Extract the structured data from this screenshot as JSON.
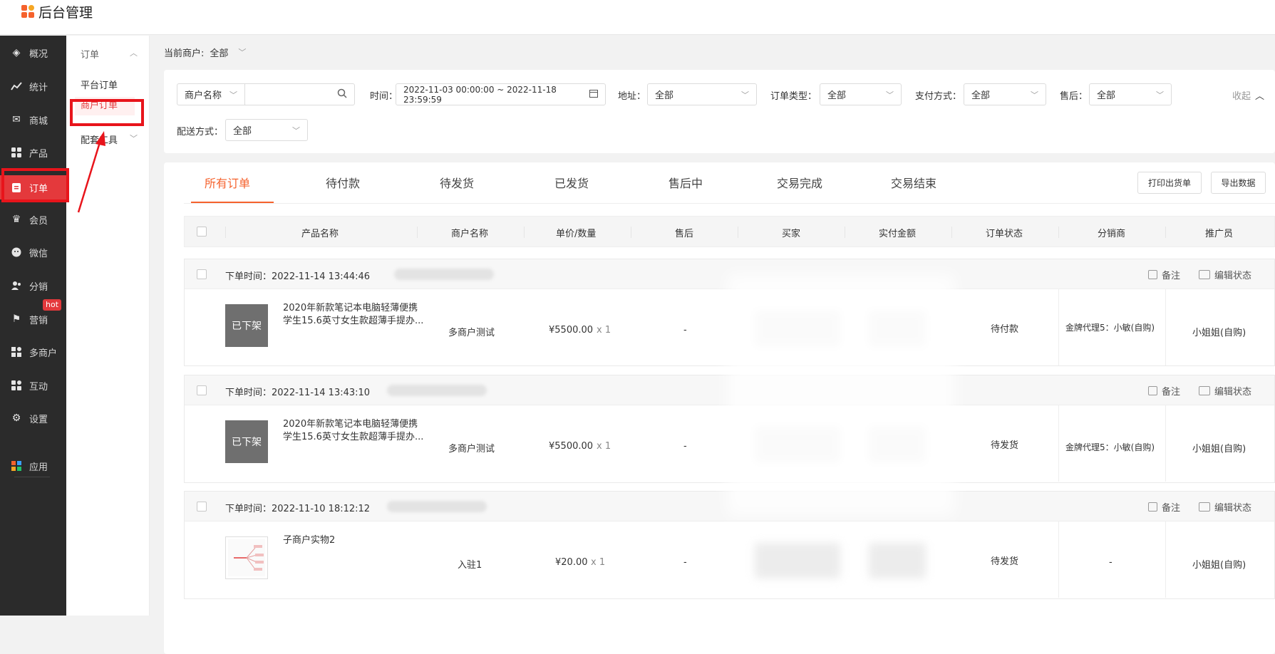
{
  "brand": {
    "title": "后台管理"
  },
  "sidebar": {
    "items": [
      {
        "label": "概况",
        "icon": "layers-icon"
      },
      {
        "label": "统计",
        "icon": "chart-icon"
      },
      {
        "label": "商城",
        "icon": "mail-icon"
      },
      {
        "label": "产品",
        "icon": "grid-icon"
      },
      {
        "label": "订单",
        "icon": "clipboard-icon",
        "active": true
      },
      {
        "label": "会员",
        "icon": "crown-icon"
      },
      {
        "label": "微信",
        "icon": "wechat-icon"
      },
      {
        "label": "分销",
        "icon": "people-icon"
      },
      {
        "label": "营销",
        "icon": "flag-icon"
      },
      {
        "label": "多商户",
        "icon": "store-icon"
      },
      {
        "label": "互动",
        "icon": "interact-icon"
      },
      {
        "label": "设置",
        "icon": "gear-icon"
      },
      {
        "label": "应用",
        "icon": "apps-icon"
      }
    ],
    "hot_badge": "hot"
  },
  "subnav": {
    "head": "订单",
    "items": [
      "平台订单",
      "商户订单",
      "配套工具"
    ]
  },
  "merchant_bar": {
    "label": "当前商户:",
    "value": "全部"
  },
  "filters": {
    "name_select": "商户名称",
    "time_label": "时间：",
    "time_value": "2022-11-03 00:00:00 ~ 2022-11-18 23:59:59",
    "address_label": "地址：",
    "address_value": "全部",
    "order_type_label": "订单类型：",
    "order_type_value": "全部",
    "pay_label": "支付方式：",
    "pay_value": "全部",
    "aftersale_label": "售后：",
    "aftersale_value": "全部",
    "collapse": "收起",
    "delivery_label": "配送方式：",
    "delivery_value": "全部"
  },
  "tabs": [
    "所有订单",
    "待付款",
    "待发货",
    "已发货",
    "售后中",
    "交易完成",
    "交易结束"
  ],
  "buttons": {
    "print": "打印出货单",
    "export": "导出数据"
  },
  "columns": [
    "产品名称",
    "商户名称",
    "单价/数量",
    "售后",
    "买家",
    "实付金额",
    "订单状态",
    "分销商",
    "推广员"
  ],
  "order_actions": {
    "note": "备注",
    "edit_status": "编辑状态"
  },
  "orders": [
    {
      "time": "下单时间：2022-11-14 13:44:46",
      "image_label": "已下架",
      "product_line1": "2020年新款笔记本电脑轻薄便携",
      "product_line2": "学生15.6英寸女生款超薄手提办...",
      "merchant": "多商户测试",
      "price": "¥5500.00",
      "qty": "x 1",
      "aftersale": "-",
      "status": "待付款",
      "distributor": "金牌代理5：小敏(自购)",
      "promoter": "小姐姐(自购)"
    },
    {
      "time": "下单时间：2022-11-14 13:43:10",
      "image_label": "已下架",
      "product_line1": "2020年新款笔记本电脑轻薄便携",
      "product_line2": "学生15.6英寸女生款超薄手提办...",
      "merchant": "多商户测试",
      "price": "¥5500.00",
      "qty": "x 1",
      "aftersale": "-",
      "status": "待发货",
      "distributor": "金牌代理5：小敏(自购)",
      "promoter": "小姐姐(自购)"
    },
    {
      "time": "下单时间：2022-11-10 18:12:12",
      "image_label": "",
      "product_line1": "子商户实物2",
      "product_line2": "",
      "merchant": "入驻1",
      "price": "¥20.00",
      "qty": "x 1",
      "aftersale": "-",
      "status": "待发货",
      "distributor": "-",
      "promoter": "小姐姐(自购)"
    }
  ],
  "colors": {
    "accent": "#f5622d",
    "sidebar_bg": "#2b2b2b",
    "active_red": "#e4393c",
    "highlight_box": "#e8141b"
  }
}
